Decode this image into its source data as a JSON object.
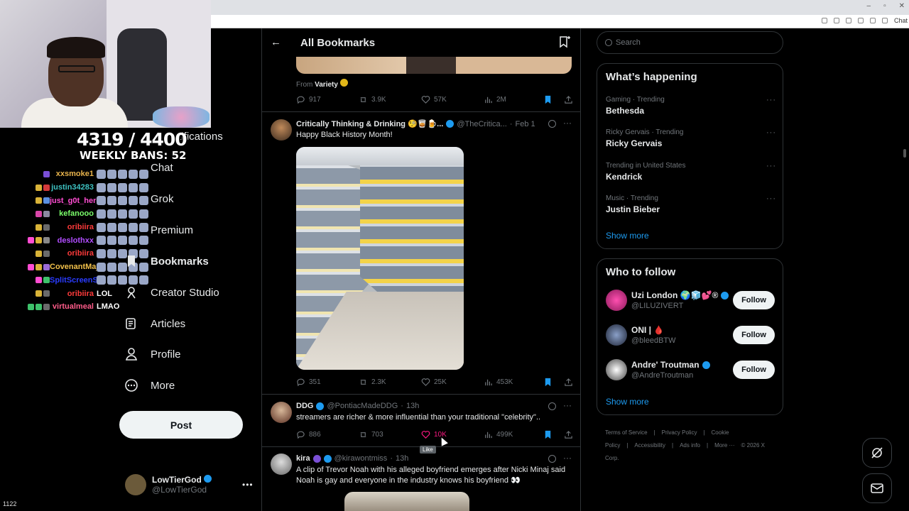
{
  "browser": {
    "chat_label": "Chat"
  },
  "overlay": {
    "count": "4319 / 4400",
    "bans": "WEEKLY BANS: 52",
    "viewer_count": "1122",
    "chat": [
      {
        "user": "xxsmoke1",
        "color": "#e9b44c",
        "msg": "",
        "badges": [
          "#7a4fd6"
        ]
      },
      {
        "user": "justin34283",
        "color": "#3ec2c2",
        "msg": "",
        "badges": [
          "#d9b338",
          "#d33a3a"
        ]
      },
      {
        "user": "just_g0t_here",
        "color": "#ff4dd2",
        "msg": "",
        "badges": [
          "#d9b338",
          "#5a8fe0"
        ]
      },
      {
        "user": "kefanooo",
        "color": "#7bff6b",
        "msg": "",
        "badges": [
          "#d946a8",
          "#8a8aa0"
        ]
      },
      {
        "user": "oribiira",
        "color": "#ff3b3b",
        "msg": "",
        "badges": [
          "#d9b338",
          "#6a6a6a"
        ]
      },
      {
        "user": "deslothxx",
        "color": "#b14dff",
        "msg": "",
        "badges": [
          "#ff4dd2",
          "#d9b338",
          "#888"
        ]
      },
      {
        "user": "oribiira",
        "color": "#ff3b3b",
        "msg": "",
        "badges": [
          "#d9b338",
          "#6a6a6a"
        ]
      },
      {
        "user": "CovenantMajor",
        "color": "#f2c14b",
        "msg": "",
        "badges": [
          "#ff4dd2",
          "#d9b338",
          "#9b6bd6"
        ]
      },
      {
        "user": "SplitScreenStre...",
        "color": "#2a3cff",
        "msg": "",
        "badges": [
          "#ff4dd2",
          "#3ec26b"
        ]
      },
      {
        "user": "oribiira",
        "color": "#ff3b3b",
        "msg": "LOL",
        "badges": [
          "#d9b338",
          "#6a6a6a"
        ]
      },
      {
        "user": "virtualmeal",
        "color": "#ff5c8a",
        "msg": "LMAO",
        "badges": [
          "#3ec26b",
          "#3ec26b",
          "#6a6a6a"
        ]
      }
    ]
  },
  "nav": {
    "notifications": "Notifications",
    "chat": "Chat",
    "grok": "Grok",
    "premium": "Premium",
    "bookmarks": "Bookmarks",
    "creator_studio": "Creator Studio",
    "articles": "Articles",
    "profile": "Profile",
    "more": "More",
    "post": "Post",
    "account_name": "LowTierGod",
    "account_handle": "@LowTierGod"
  },
  "feed": {
    "title": "All Bookmarks",
    "prev": {
      "from_label": "From",
      "from_name": "Variety",
      "replies": "917",
      "reposts": "3.9K",
      "likes": "57K",
      "views": "2M"
    },
    "tweets": [
      {
        "name": "Critically Thinking & Drinking 🧐🥃🍺...",
        "handle": "@TheCritica...",
        "time": "Feb 1",
        "text": "Happy Black History Month!",
        "replies": "351",
        "reposts": "2.3K",
        "likes": "25K",
        "views": "453K"
      },
      {
        "name": "DDG",
        "handle": "@PontiacMadeDDG",
        "time": "13h",
        "text": "streamers are richer & more influential than your traditional \"celebrity\"..",
        "replies": "886",
        "reposts": "703",
        "likes": "10K",
        "views": "499K",
        "tooltip": "Like"
      },
      {
        "name": "kira",
        "handle": "@kirawontmiss",
        "time": "13h",
        "text": "A clip of Trevor Noah with his alleged boyfriend emerges after Nicki Minaj said Noah is gay and everyone in the industry knows his boyfriend 👀"
      }
    ]
  },
  "sidebar": {
    "search_placeholder": "Search",
    "happening_title": "What’s happening",
    "trends": [
      {
        "context": "Gaming · Trending",
        "name": "Bethesda"
      },
      {
        "context": "Ricky Gervais · Trending",
        "name": "Ricky Gervais"
      },
      {
        "context": "Trending in United States",
        "name": "Kendrick"
      },
      {
        "context": "Music · Trending",
        "name": "Justin Bieber"
      }
    ],
    "show_more": "Show more",
    "who_title": "Who to follow",
    "follow": [
      {
        "name": "Uzi London 🌍🧊💕®",
        "handle": "@LILUZIVERT",
        "button": "Follow"
      },
      {
        "name": "ONI | 🩸",
        "handle": "@bleedBTW",
        "button": "Follow"
      },
      {
        "name": "Andre' Troutman",
        "handle": "@AndreTroutman",
        "button": "Follow"
      }
    ],
    "footer": [
      "Terms of Service",
      "|",
      "Privacy Policy",
      "|",
      "Cookie Policy",
      "|",
      "Accessibility",
      "|",
      "Ads info",
      "|",
      "More ···",
      "© 2026 X Corp."
    ]
  },
  "colors": {
    "accent": "#1d9bf0",
    "like": "#f91880",
    "bg": "#000000",
    "border": "#2f3336"
  }
}
